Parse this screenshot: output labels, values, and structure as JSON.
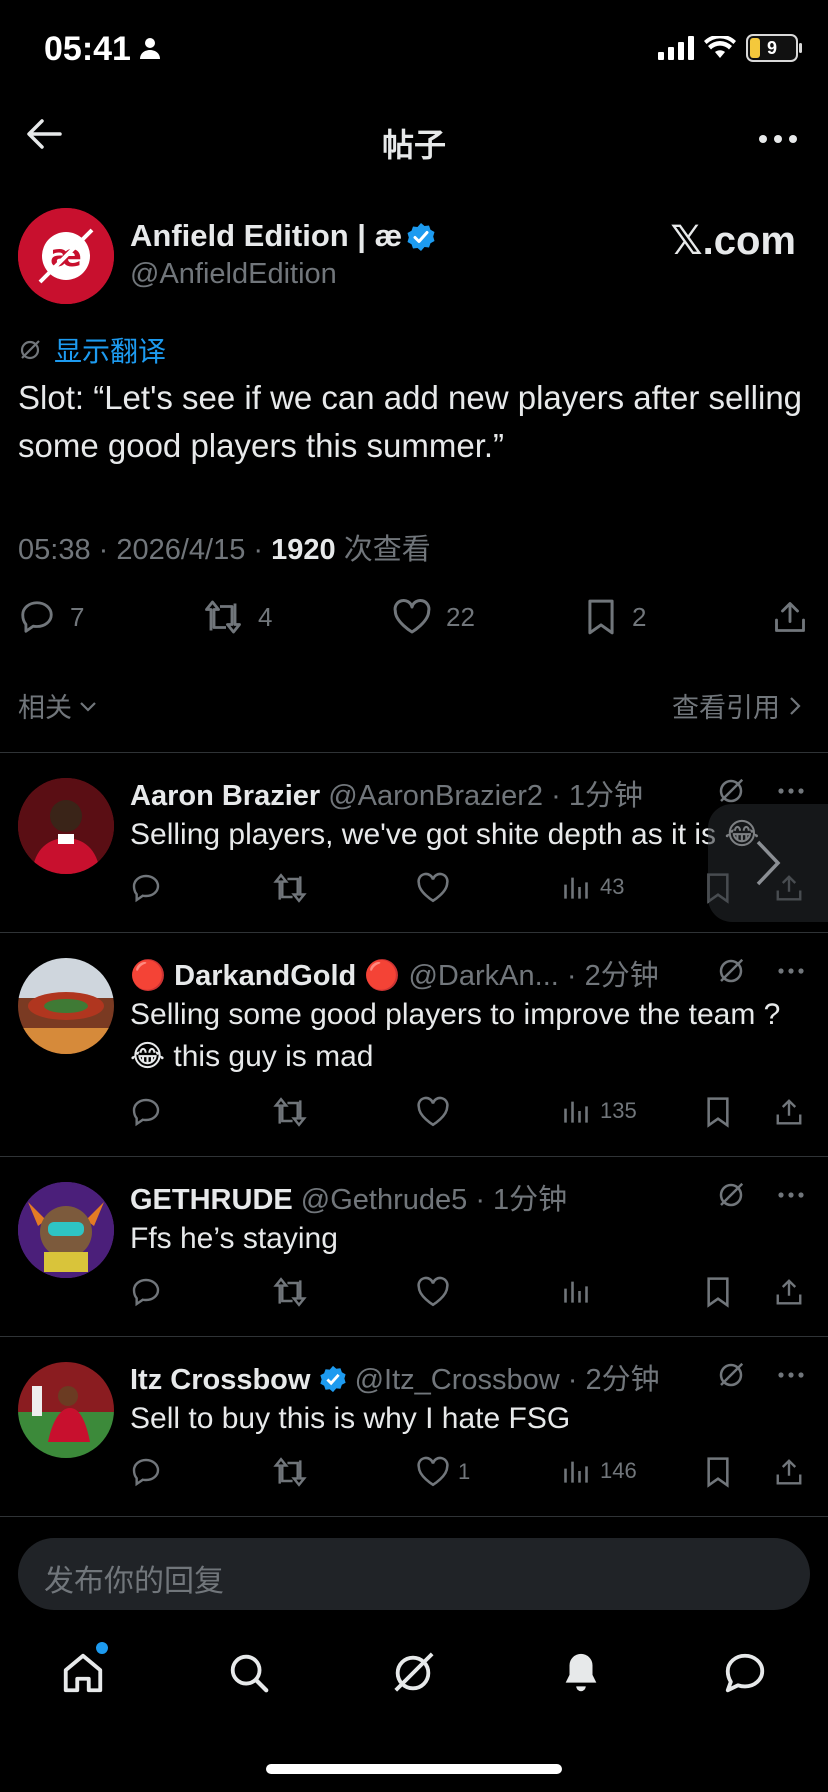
{
  "status_bar": {
    "time": "05:41",
    "battery": "9"
  },
  "nav": {
    "title": "帖子"
  },
  "post": {
    "author_name": "Anfield Edition | æ",
    "author_handle": "@AnfieldEdition",
    "source": "𝕏.com",
    "translate_label": "显示翻译",
    "text": "Slot: “Let's see if we can add new players after selling some good players this summer.”",
    "meta_time": "05:38 · 2026/4/15 · ",
    "views_count": "1920",
    "views_label": " 次查看",
    "replies": "7",
    "reposts": "4",
    "likes": "22",
    "bookmarks": "2",
    "avatar_text": "æ"
  },
  "related_label": "相关",
  "view_quotes_label": "查看引用",
  "replies": [
    {
      "name": "Aaron Brazier",
      "handle": "@AaronBrazier2 · 1分钟",
      "text": "Selling players, we've got shite depth as it is 😂",
      "reposts": "",
      "likes": "",
      "views": "43"
    },
    {
      "name_prefix": "🔴 ",
      "name": "DarkandGold",
      "name_suffix": " 🔴",
      "handle": " @DarkAn... · 2分钟",
      "text": "Selling some good players to improve the team ? 😂 this guy is mad",
      "likes": "",
      "views": "135"
    },
    {
      "name": "GETHRUDE",
      "handle": " @Gethrude5 · 1分钟",
      "text": "Ffs he’s staying",
      "likes": "",
      "views": ""
    },
    {
      "name": "Itz Crossbow",
      "handle": " @Itz_Crossbow · 2分钟",
      "text": "Sell to buy this is why I hate FSG",
      "likes": "1",
      "views": "146"
    }
  ],
  "reply_box": {
    "placeholder": "发布你的回复"
  },
  "colors": {
    "accent": "#1d9bf0",
    "muted": "#71767b",
    "background": "#000000",
    "brand_red": "#c8102e"
  }
}
